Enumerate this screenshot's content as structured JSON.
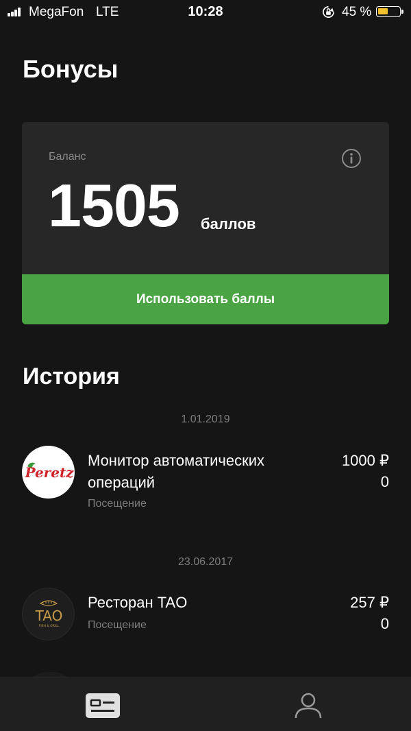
{
  "status_bar": {
    "carrier": "MegaFon",
    "network": "LTE",
    "time": "10:28",
    "battery_percent": "45 %",
    "battery_color": "#f2c12e"
  },
  "page_title": "Бонусы",
  "balance": {
    "label": "Баланс",
    "value": "1505",
    "unit": "баллов",
    "info_icon": "info-icon",
    "use_button_label": "Использовать баллы",
    "use_button_color": "#4aa443"
  },
  "history": {
    "title": "История",
    "groups": [
      {
        "date": "1.01.2019",
        "items": [
          {
            "logo": "Peretz",
            "title": "Монитор автоматических операций",
            "subtitle": "Посещение",
            "amount": "1000 ₽",
            "points": "0"
          }
        ]
      },
      {
        "date": "23.06.2017",
        "items": [
          {
            "logo": "TAO",
            "logo_sub": "FISH & GRILL",
            "title": "Ресторан TAO",
            "subtitle": "Посещение",
            "amount": "257 ₽",
            "points": "0"
          }
        ]
      }
    ]
  },
  "tab_bar": {
    "tabs": [
      {
        "icon": "loyalty-card-icon",
        "active": true
      },
      {
        "icon": "profile-icon",
        "active": false
      }
    ]
  }
}
